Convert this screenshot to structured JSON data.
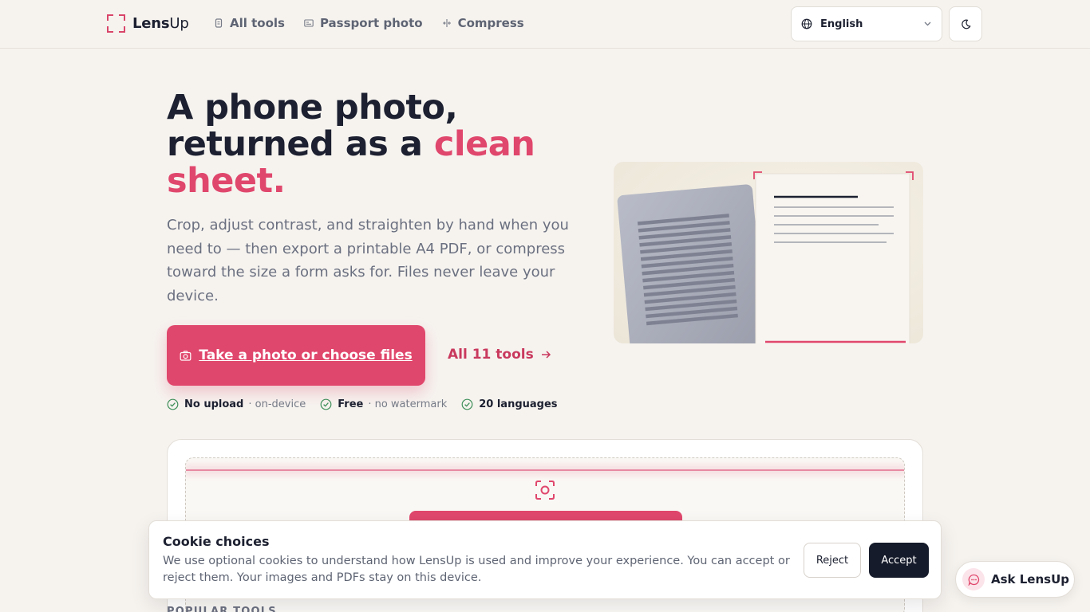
{
  "header": {
    "logo_bold": "Lens",
    "logo_regular": "Up",
    "nav": [
      {
        "label": "All tools",
        "icon": "document-icon"
      },
      {
        "label": "Passport photo",
        "icon": "id-card-icon"
      },
      {
        "label": "Compress",
        "icon": "compress-icon"
      }
    ],
    "language": "English",
    "theme_icon": "moon-icon"
  },
  "hero": {
    "title_part1": "A phone photo, returned as a ",
    "title_accent": "clean sheet.",
    "subtitle": "Crop, adjust contrast, and straighten by hand when you need to — then export a printable A4 PDF, or compress toward the size a form asks for. Files never leave your device.",
    "cta_label": "Take a photo or choose files",
    "all_tools_label": "All 11 tools",
    "badges": [
      {
        "bold": "No upload",
        "muted": "· on-device"
      },
      {
        "bold": "Free",
        "muted": "· no watermark"
      },
      {
        "bold": "20 languages",
        "muted": ""
      }
    ]
  },
  "section": {
    "popular_label": "POPULAR TOOLS"
  },
  "cookie": {
    "title": "Cookie choices",
    "text": "We use optional cookies to understand how LensUp is used and improve your experience. You can accept or reject them. Your images and PDFs stay on this device.",
    "reject_label": "Reject",
    "accept_label": "Accept"
  },
  "assistant": {
    "label": "Ask LensUp"
  },
  "colors": {
    "accent": "#e0476c",
    "background": "#f6f3ef",
    "text_dark": "#1c2030",
    "text_muted": "#6b7080",
    "accept_bg": "#161b2b"
  }
}
